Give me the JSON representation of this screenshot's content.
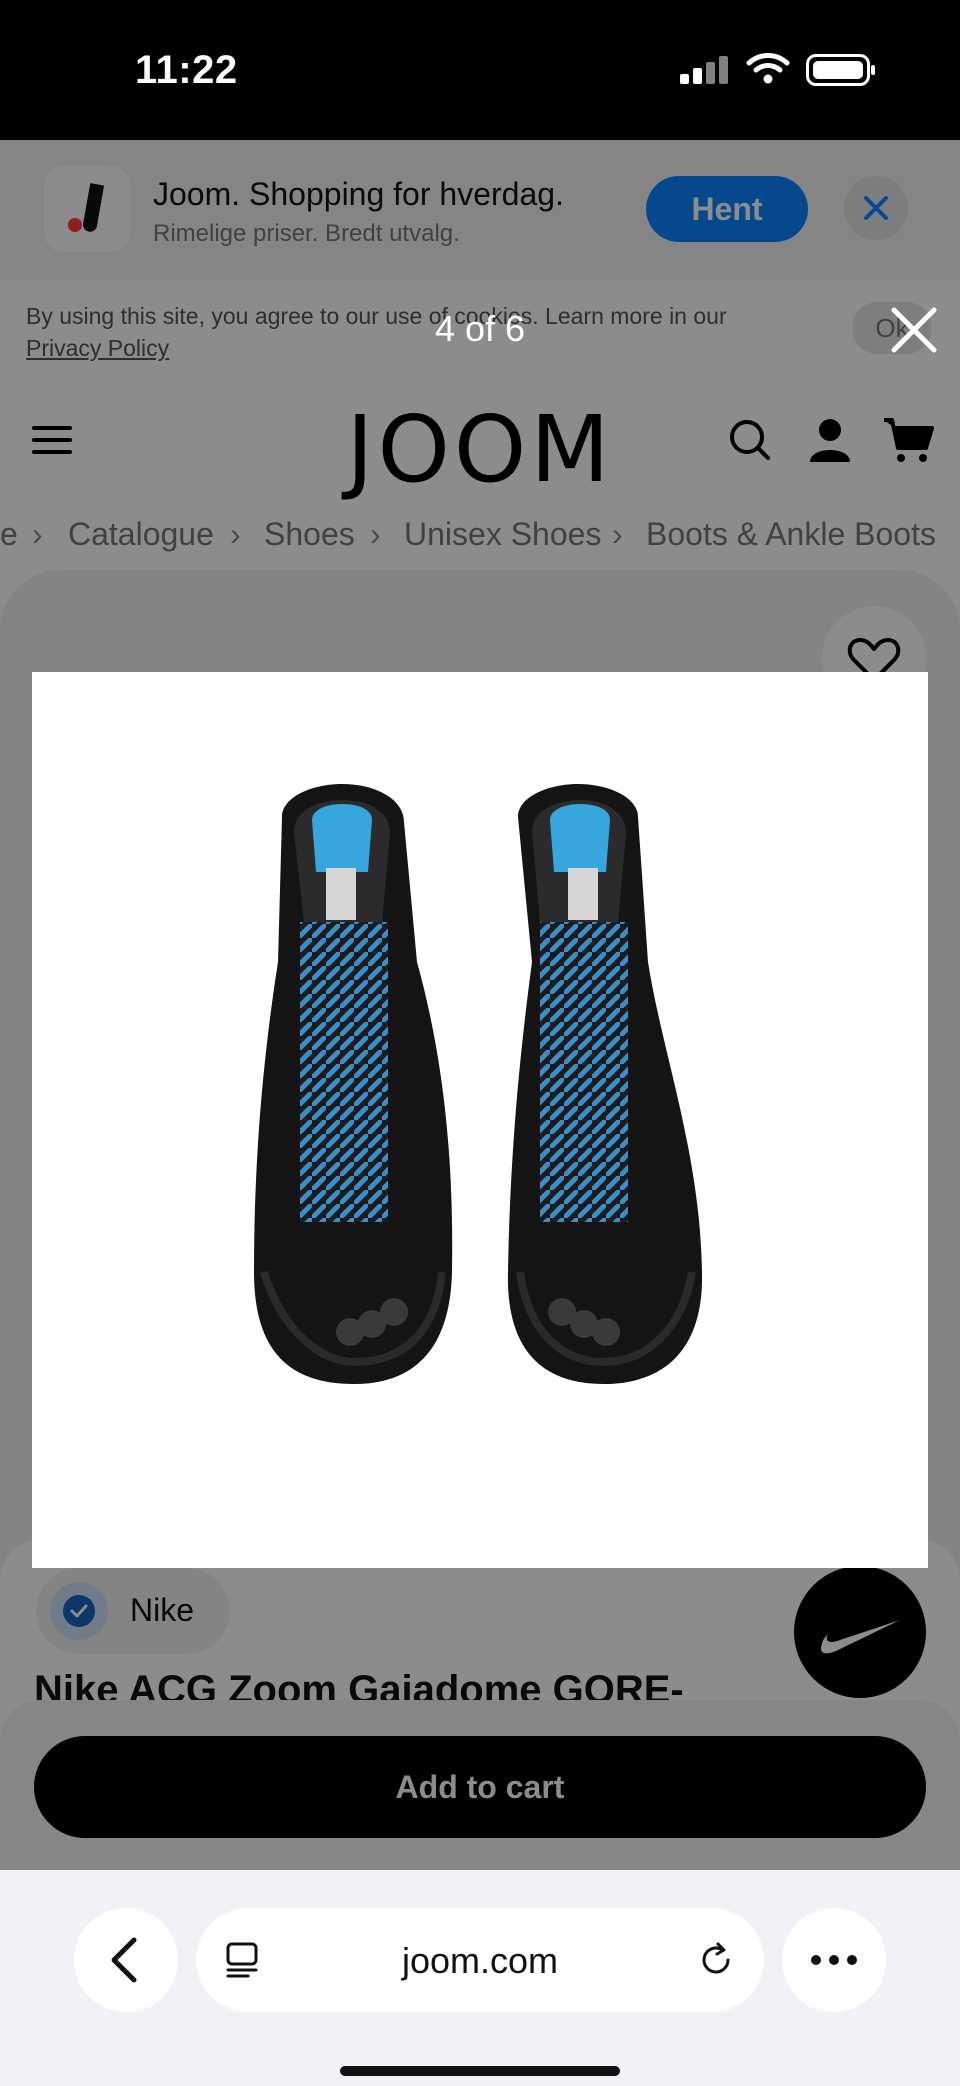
{
  "status_bar": {
    "time": "11:22"
  },
  "app_banner": {
    "title": "Joom. Shopping for hverdag.",
    "subtitle": "Rimelige priser. Bredt utvalg.",
    "get_label": "Hent"
  },
  "cookie": {
    "text": "By using this site, you agree to our use of cookies. Learn more in our",
    "link": "Privacy Policy",
    "ok_label": "Ok"
  },
  "header": {
    "logo": "JOOM"
  },
  "breadcrumb": [
    "e",
    "Catalogue",
    "Shoes",
    "Unisex Shoes",
    "Boots & Ankle Boots"
  ],
  "gallery": {
    "counter": "4 of 6"
  },
  "product": {
    "brand": "Nike",
    "title": "Nike ACG Zoom Gaiadome GORE-",
    "add_to_cart": "Add to cart"
  },
  "safari": {
    "url": "joom.com"
  },
  "colors": {
    "accent_blue": "#0a84ff",
    "verified_blue": "#1565c0",
    "lace_blue": "#3a8fc9",
    "insole_blue": "#36a6dd"
  }
}
